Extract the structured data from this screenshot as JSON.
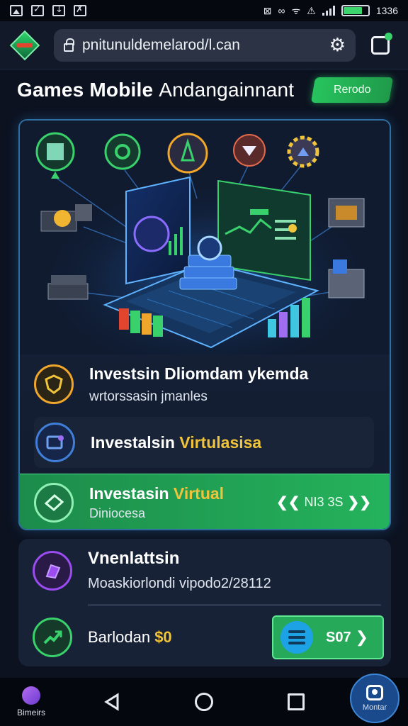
{
  "status_bar": {
    "time": "1336",
    "icons": [
      "photo-icon",
      "check-icon",
      "download-icon",
      "image-icon",
      "mute-icon",
      "link-icon",
      "wifi-icon",
      "signal-icon",
      "battery-icon"
    ]
  },
  "browser": {
    "url": "pnitunuldemelarod/l.can",
    "icons": [
      "lock-icon",
      "gear-icon",
      "tabs-icon"
    ]
  },
  "header": {
    "title_bold": "Games Mobile",
    "title_light": "Andangainnant",
    "button_label": "Rerodo"
  },
  "main_card": {
    "features": [
      {
        "title": "Investsin Dliomdam ykemda",
        "subtitle": "wrtorssasin jmanles",
        "icon": "shield-icon",
        "color": "#f0a62a"
      },
      {
        "title_a": "Investalsin ",
        "title_b": "Virtulasisa",
        "icon": "message-icon",
        "color": "#3f7fd8"
      },
      {
        "title_a": "Investasin ",
        "title_b": "Virtual",
        "subtitle": "Diniocesa",
        "icon": "ticket-icon",
        "color": "#39d16b",
        "nav_label": "NI3 3S"
      }
    ]
  },
  "card2": {
    "title": "Vnenlattsin",
    "subtitle": "Moaskiorlondi vipodo2/28112",
    "action_text": "Barlodan ",
    "action_highlight": "$0",
    "button_label": "S07",
    "icons": [
      "cube-icon",
      "chart-icon",
      "wave-icon"
    ]
  },
  "bottom_nav": {
    "left_label": "Bimeirs",
    "right_label": "Montar"
  },
  "colors": {
    "accent_green": "#27c45e",
    "accent_gold": "#f0c43a",
    "accent_blue": "#2e6fa0",
    "background": "#0c1220"
  }
}
